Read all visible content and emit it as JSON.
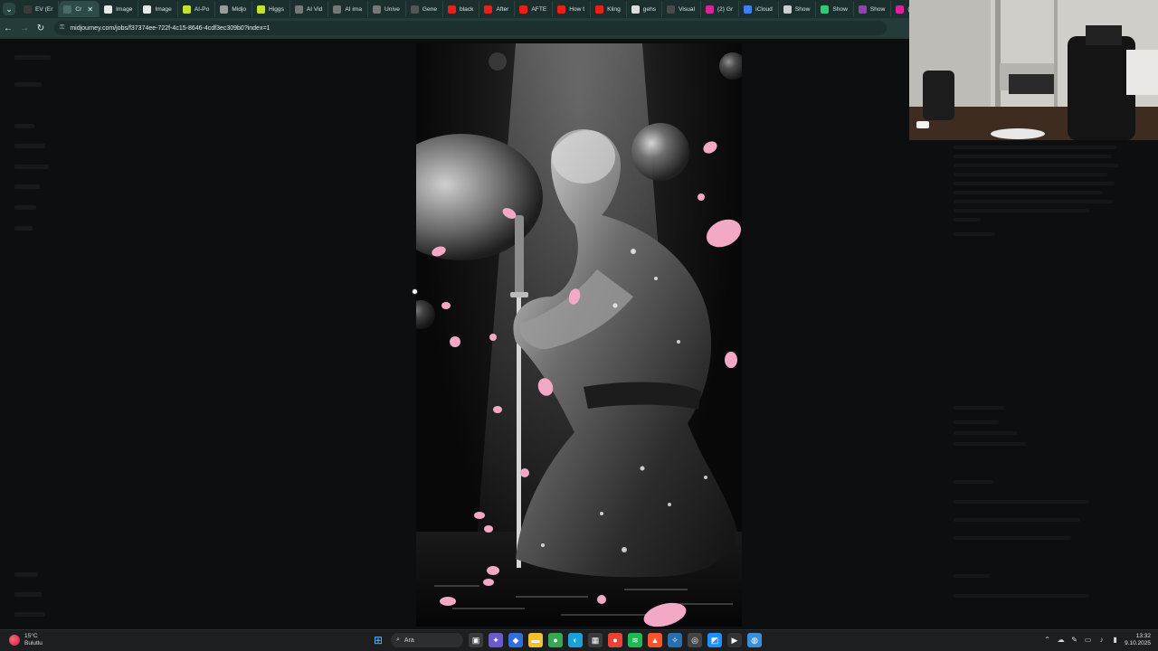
{
  "browser": {
    "tabs": [
      {
        "label": "EV (Er",
        "favicon_color": "#3a3a3a",
        "active": false
      },
      {
        "label": "Cr",
        "favicon_color": "#4b6a69",
        "active": true
      },
      {
        "label": "Image",
        "favicon_color": "#e8e8e8",
        "active": false
      },
      {
        "label": "Image",
        "favicon_color": "#e8e8e8",
        "active": false
      },
      {
        "label": "AI-Po",
        "favicon_color": "#c6e12a",
        "active": false
      },
      {
        "label": "Midjo",
        "favicon_color": "#9a9a9a",
        "active": false
      },
      {
        "label": "Higgs",
        "favicon_color": "#c6e12a",
        "active": false
      },
      {
        "label": "AI Vid",
        "favicon_color": "#777777",
        "active": false
      },
      {
        "label": "AI ima",
        "favicon_color": "#777777",
        "active": false
      },
      {
        "label": "Unive",
        "favicon_color": "#777777",
        "active": false
      },
      {
        "label": "Gene",
        "favicon_color": "#555555",
        "active": false
      },
      {
        "label": "black",
        "favicon_color": "#e62117",
        "active": false
      },
      {
        "label": "After",
        "favicon_color": "#e62117",
        "active": false
      },
      {
        "label": "AFTE",
        "favicon_color": "#e62117",
        "active": false
      },
      {
        "label": "How t",
        "favicon_color": "#e62117",
        "active": false
      },
      {
        "label": "Kling",
        "favicon_color": "#e62117",
        "active": false
      },
      {
        "label": "gehs",
        "favicon_color": "#dddddd",
        "active": false
      },
      {
        "label": "Visual",
        "favicon_color": "#4a4a4a",
        "active": false
      },
      {
        "label": "(2) Gr",
        "favicon_color": "#d6249f",
        "active": false
      },
      {
        "label": "iCloud",
        "favicon_color": "#3b82f6",
        "active": false
      },
      {
        "label": "Show",
        "favicon_color": "#cfcfcf",
        "active": false
      },
      {
        "label": "Show",
        "favicon_color": "#2ecc71",
        "active": false
      },
      {
        "label": "Show",
        "favicon_color": "#8e44ad",
        "active": false
      },
      {
        "label": "(2) In",
        "favicon_color": "#d6249f",
        "active": false
      }
    ],
    "url": "midjourney.com/jobs/f37374ee-722f-4c15-8646-4cdf3ec309b0?index=1"
  },
  "taskbar": {
    "weather_temp": "15°C",
    "weather_desc": "Bulutlu",
    "search_placeholder": "Ara",
    "time": "13:32",
    "date": "9.10.2025",
    "apps": [
      {
        "name": "task-view-icon",
        "color": "#3a3b3e",
        "glyph": "▣"
      },
      {
        "name": "copilot-icon",
        "color": "#6a5acd",
        "glyph": "✦"
      },
      {
        "name": "edge-copilot-icon",
        "color": "#2f6fde",
        "glyph": "◆"
      },
      {
        "name": "file-explorer-icon",
        "color": "#f2c230",
        "glyph": "▬"
      },
      {
        "name": "chrome-icon",
        "color": "#34a853",
        "glyph": "●"
      },
      {
        "name": "edge-icon",
        "color": "#1ba0d8",
        "glyph": "◐"
      },
      {
        "name": "store-icon",
        "color": "#3a3b3e",
        "glyph": "▦"
      },
      {
        "name": "chrome-alt-icon",
        "color": "#ea4335",
        "glyph": "●"
      },
      {
        "name": "spotify-icon",
        "color": "#1db954",
        "glyph": "≋"
      },
      {
        "name": "brave-icon",
        "color": "#fb542b",
        "glyph": "▲"
      },
      {
        "name": "app-icon-1",
        "color": "#2a6fb0",
        "glyph": "✧"
      },
      {
        "name": "app-icon-2",
        "color": "#444444",
        "glyph": "◎"
      },
      {
        "name": "app-icon-3",
        "color": "#1e90ff",
        "glyph": "◩"
      },
      {
        "name": "media-player-icon",
        "color": "#333333",
        "glyph": "▶"
      },
      {
        "name": "app-icon-4",
        "color": "#3a8fd6",
        "glyph": "◍"
      }
    ]
  }
}
